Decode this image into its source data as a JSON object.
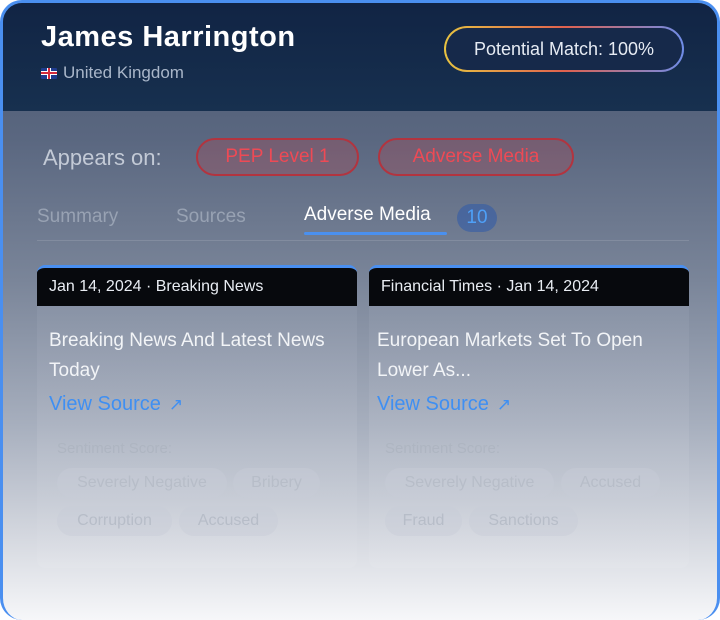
{
  "profile": {
    "name": "James Harrington",
    "country": "United Kingdom",
    "flag_icon": "uk-flag-icon",
    "match_label": "Potential Match: 100%"
  },
  "appears_on": {
    "label": "Appears on:",
    "badges": [
      "PEP Level 1",
      "Adverse Media"
    ]
  },
  "tabs": {
    "items": [
      "Summary",
      "Sources",
      "Adverse Media"
    ],
    "active": "Adverse Media",
    "count": "10"
  },
  "articles": [
    {
      "header": "Jan 14, 2024 · Breaking News",
      "title": "Breaking News And Latest News Today",
      "link_label": "View Source",
      "sentiment_label": "Sentiment Score:",
      "tags": [
        "Severely Negative",
        "Bribery",
        "Corruption",
        "Accused"
      ]
    },
    {
      "header": "Financial Times · Jan 14, 2024",
      "title": "European Markets Set To Open Lower As...",
      "link_label": "View Source",
      "sentiment_label": "Sentiment Score:",
      "tags": [
        "Severely Negative",
        "Accused",
        "Fraud",
        "Sanctions"
      ]
    }
  ],
  "colors": {
    "accent": "#4a8ff0",
    "header_bg": "#132849",
    "badge_red": "#ee4a55",
    "link_blue": "#3f8ff2"
  }
}
